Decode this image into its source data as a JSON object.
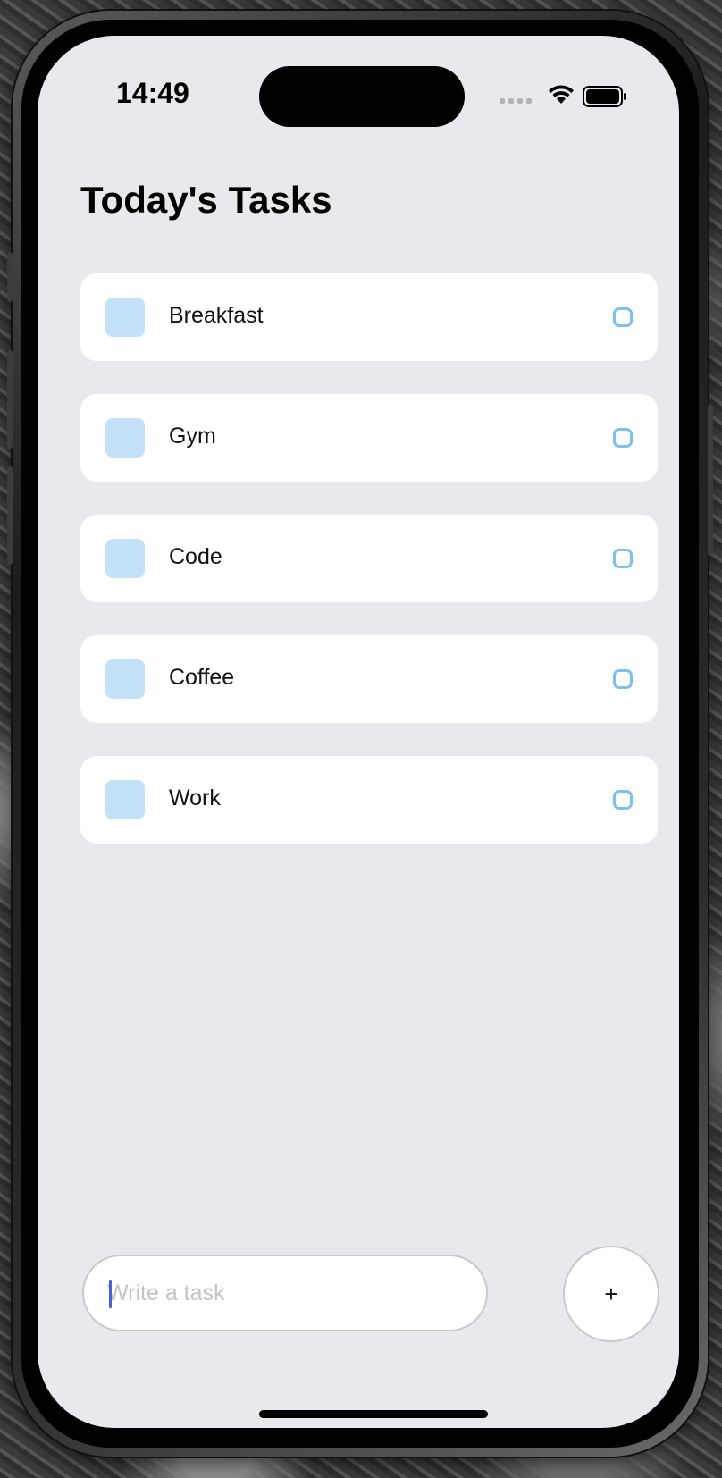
{
  "status_bar": {
    "time": "14:49",
    "signal_icon": "signal-dots-icon",
    "wifi_icon": "wifi-icon",
    "battery_icon": "battery-icon"
  },
  "header": {
    "title": "Today's Tasks"
  },
  "tasks": [
    {
      "label": "Breakfast",
      "completed": false
    },
    {
      "label": "Gym",
      "completed": false
    },
    {
      "label": "Code",
      "completed": false
    },
    {
      "label": "Coffee",
      "completed": false
    },
    {
      "label": "Work",
      "completed": false
    }
  ],
  "composer": {
    "input_value": "",
    "input_placeholder": "Write a task",
    "add_label": "+"
  },
  "colors": {
    "screen_background": "#e8e9ed",
    "task_square": "#c3e2f7",
    "task_circle": "#7ec0ee",
    "caret": "#4a5fd1"
  }
}
